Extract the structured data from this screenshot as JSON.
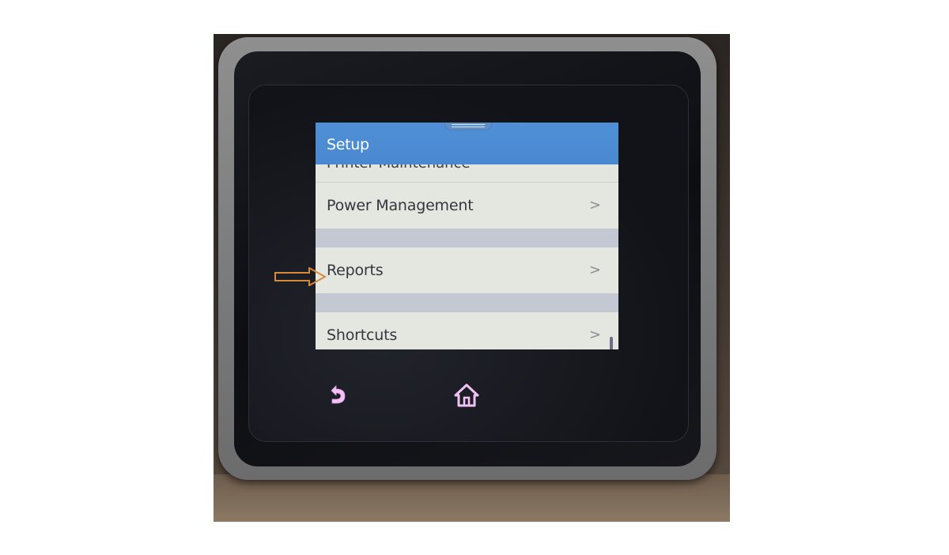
{
  "screen": {
    "title": "Setup",
    "cut_item_label": "Printer Maintenance",
    "items": [
      {
        "label": "Power Management",
        "chevron": ">"
      },
      {
        "label": "Reports",
        "chevron": ">"
      },
      {
        "label": "Shortcuts",
        "chevron": ">"
      }
    ]
  },
  "buttons": {
    "back_icon": "back-arrow-icon",
    "home_icon": "home-icon"
  },
  "colors": {
    "title_bar": "#4a89d0",
    "list_bg": "#e4e7df",
    "separator": "#c4c8d3",
    "nav_icon": "#f0b8f4",
    "annotation_arrow": "#d7893a"
  }
}
